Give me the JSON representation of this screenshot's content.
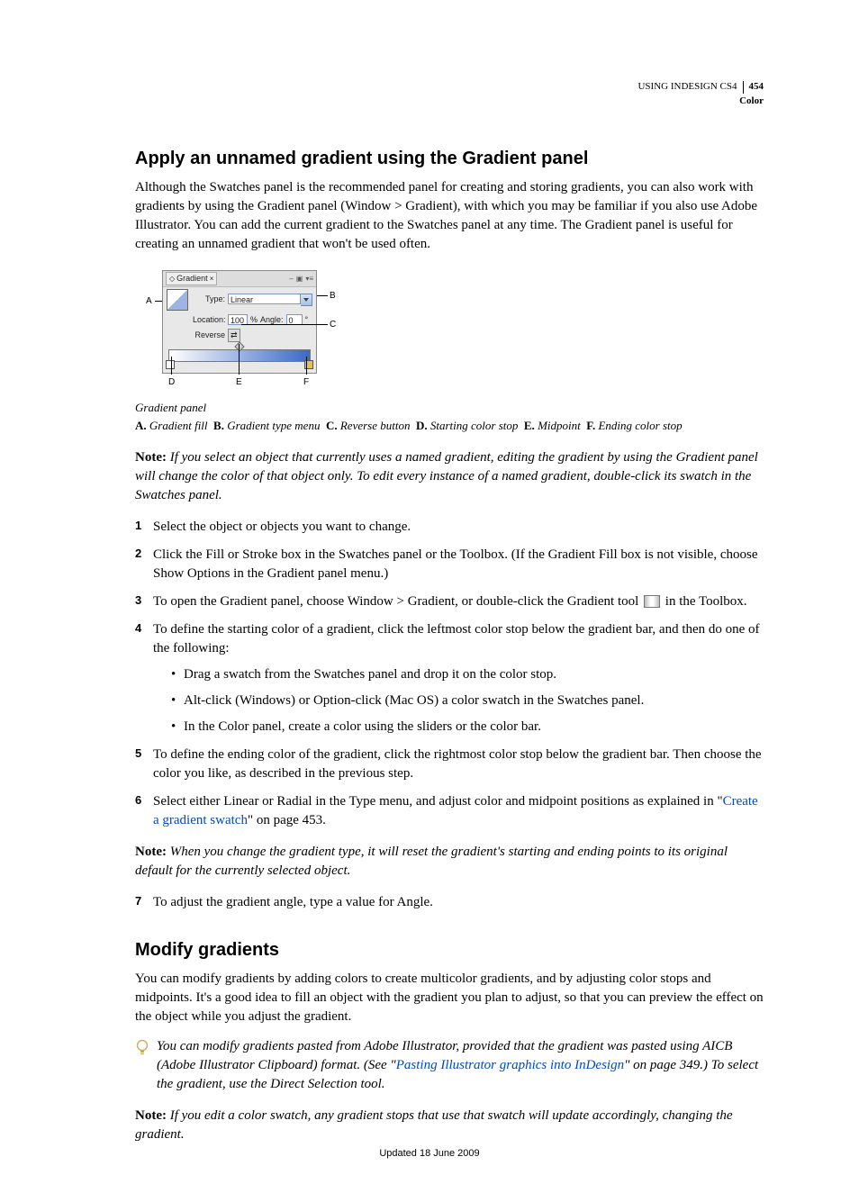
{
  "header": {
    "doc_title": "USING INDESIGN CS4",
    "page_number": "454",
    "section": "Color"
  },
  "section1": {
    "heading": "Apply an unnamed gradient using the Gradient panel",
    "intro": "Although the Swatches panel is the recommended panel for creating and storing gradients, you can also work with gradients by using the Gradient panel (Window > Gradient), with which you may be familiar if you also use Adobe Illustrator. You can add the current gradient to the Swatches panel at any time. The Gradient panel is useful for creating an unnamed gradient that won't be used often.",
    "figure": {
      "panel_tab": "Gradient",
      "type_label": "Type:",
      "type_value": "Linear",
      "location_label": "Location:",
      "location_value": "100",
      "percent": "%",
      "angle_label": "Angle:",
      "angle_value": "0",
      "reverse_label": "Reverse",
      "callouts": {
        "A": "A",
        "B": "B",
        "C": "C",
        "D": "D",
        "E": "E",
        "F": "F"
      },
      "caption": "Gradient panel",
      "legend": {
        "A": "Gradient fill",
        "B": "Gradient type menu",
        "C": "Reverse button",
        "D": "Starting color stop",
        "E": "Midpoint",
        "F": "Ending color stop"
      }
    },
    "note1_label": "Note:",
    "note1": "If you select an object that currently uses a named gradient, editing the gradient by using the Gradient panel will change the color of that object only. To edit every instance of a named gradient, double-click its swatch in the Swatches panel.",
    "steps": {
      "s1": "Select the object or objects you want to change.",
      "s2": "Click the Fill or Stroke box in the Swatches panel or the Toolbox. (If the Gradient Fill box is not visible, choose Show Options in the Gradient panel menu.)",
      "s3a": "To open the Gradient panel, choose Window > Gradient, or double-click the Gradient tool ",
      "s3b": " in the Toolbox.",
      "s4": "To define the starting color of a gradient, click the leftmost color stop below the gradient bar, and then do one of the following:",
      "s4_b1": "Drag a swatch from the Swatches panel and drop it on the color stop.",
      "s4_b2": "Alt-click (Windows) or Option-click (Mac OS) a color swatch in the Swatches panel.",
      "s4_b3": "In the Color panel, create a color using the sliders or the color bar.",
      "s5": "To define the ending color of the gradient, click the rightmost color stop below the gradient bar. Then choose the color you like, as described in the previous step.",
      "s6a": "Select either Linear or Radial in the Type menu, and adjust color and midpoint positions as explained in \"",
      "s6_link": "Create a gradient swatch",
      "s6b": "\" on page 453.",
      "note2_label": "Note:",
      "note2": "When you change the gradient type, it will reset the gradient's starting and ending points to its original default for the currently selected object.",
      "s7": "To adjust the gradient angle, type a value for Angle."
    }
  },
  "section2": {
    "heading": "Modify gradients",
    "p1": "You can modify gradients by adding colors to create multicolor gradients, and by adjusting color stops and midpoints. It's a good idea to fill an object with the gradient you plan to adjust, so that you can preview the effect on the object while you adjust the gradient.",
    "tip_a": "You can modify gradients pasted from Adobe Illustrator, provided that the gradient was pasted using AICB (Adobe Illustrator Clipboard) format. (See \"",
    "tip_link": "Pasting Illustrator graphics into InDesign",
    "tip_b": "\" on page 349.) To select the gradient, use the Direct Selection tool.",
    "note_label": "Note:",
    "note": "If you edit a color swatch, any gradient stops that use that swatch will update accordingly, changing the gradient."
  },
  "footer": "Updated 18 June 2009"
}
